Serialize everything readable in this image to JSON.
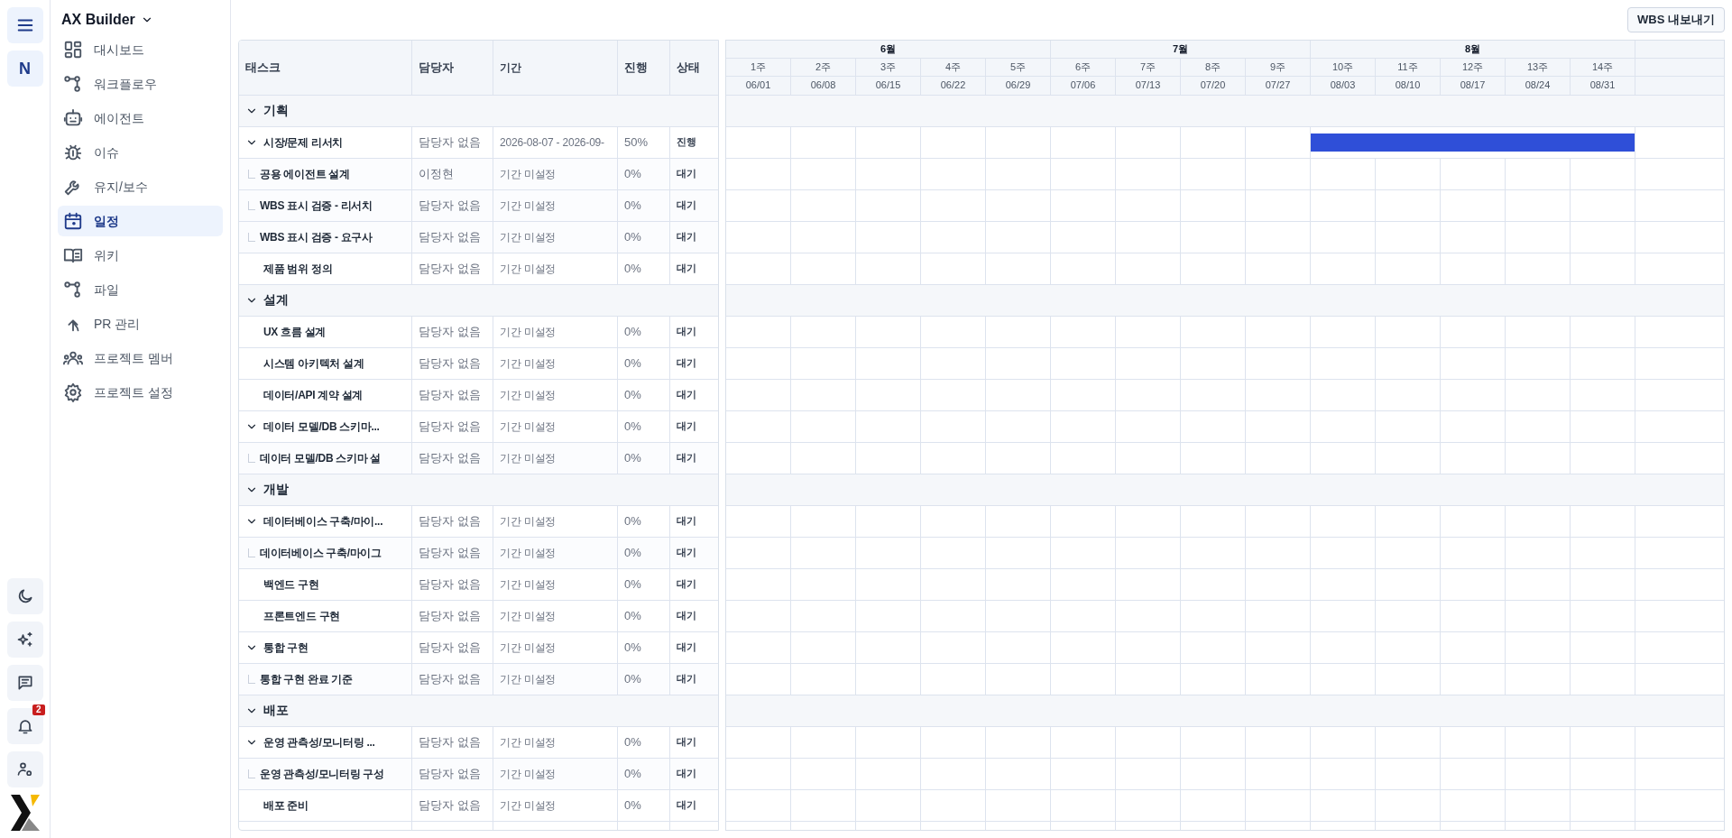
{
  "rail": {
    "avatar": "N",
    "notification_count": "2"
  },
  "project": {
    "title": "AX Builder"
  },
  "nav": [
    {
      "label": "대시보드",
      "selected": false
    },
    {
      "label": "워크플로우",
      "selected": false
    },
    {
      "label": "에이전트",
      "selected": false
    },
    {
      "label": "이슈",
      "selected": false
    },
    {
      "label": "유지/보수",
      "selected": false
    },
    {
      "label": "일정",
      "selected": true
    },
    {
      "label": "위키",
      "selected": false
    },
    {
      "label": "파일",
      "selected": false
    },
    {
      "label": "PR 관리",
      "selected": false
    },
    {
      "label": "프로젝트 멤버",
      "selected": false
    },
    {
      "label": "프로젝트 설정",
      "selected": false
    }
  ],
  "export_button": "WBS 내보내기",
  "table": {
    "columns": [
      "태스크",
      "담당자",
      "기간",
      "진행",
      "상태"
    ]
  },
  "months": [
    {
      "label": "6월",
      "weeks": [
        {
          "label": "1주",
          "date": "06/01"
        },
        {
          "label": "2주",
          "date": "06/08"
        },
        {
          "label": "3주",
          "date": "06/15"
        },
        {
          "label": "4주",
          "date": "06/22"
        },
        {
          "label": "5주",
          "date": "06/29"
        }
      ]
    },
    {
      "label": "7월",
      "weeks": [
        {
          "label": "6주",
          "date": "07/06"
        },
        {
          "label": "7주",
          "date": "07/13"
        },
        {
          "label": "8주",
          "date": "07/20"
        },
        {
          "label": "9주",
          "date": "07/27"
        }
      ]
    },
    {
      "label": "8월",
      "weeks": [
        {
          "label": "10주",
          "date": "08/03"
        },
        {
          "label": "11주",
          "date": "08/10"
        },
        {
          "label": "12주",
          "date": "08/17"
        },
        {
          "label": "13주",
          "date": "08/24"
        },
        {
          "label": "14주",
          "date": "08/31"
        }
      ]
    }
  ],
  "groups": [
    {
      "name": "기획",
      "expanded": true,
      "tasks": [
        {
          "name": "시장/문제 리서치",
          "assignee": "담당자 없음",
          "period": "2026-08-07 - 2026-09-",
          "progress": "50%",
          "status": "진행",
          "expanded": true,
          "timeline": [
            false,
            false,
            false,
            false,
            false,
            false,
            false,
            false,
            false,
            true,
            true,
            true,
            true,
            true
          ],
          "children": [
            {
              "name": "공용 에이전트 설계",
              "assignee": "이정현",
              "period": "기간 미설정",
              "progress": "0%",
              "status": "대기"
            },
            {
              "name": "WBS 표시 검증 - 리서치",
              "assignee": "담당자 없음",
              "period": "기간 미설정",
              "progress": "0%",
              "status": "대기"
            },
            {
              "name": "WBS 표시 검증 - 요구사",
              "assignee": "담당자 없음",
              "period": "기간 미설정",
              "progress": "0%",
              "status": "대기"
            }
          ]
        },
        {
          "name": "제품 범위 정의",
          "assignee": "담당자 없음",
          "period": "기간 미설정",
          "progress": "0%",
          "status": "대기"
        }
      ]
    },
    {
      "name": "설계",
      "expanded": true,
      "tasks": [
        {
          "name": "UX 흐름 설계",
          "assignee": "담당자 없음",
          "period": "기간 미설정",
          "progress": "0%",
          "status": "대기"
        },
        {
          "name": "시스템 아키텍처 설계",
          "assignee": "담당자 없음",
          "period": "기간 미설정",
          "progress": "0%",
          "status": "대기"
        },
        {
          "name": "데이터/API 계약 설계",
          "assignee": "담당자 없음",
          "period": "기간 미설정",
          "progress": "0%",
          "status": "대기"
        },
        {
          "name": "데이터 모델/DB 스키마...",
          "assignee": "담당자 없음",
          "period": "기간 미설정",
          "progress": "0%",
          "status": "대기",
          "expanded": true,
          "children": [
            {
              "name": "데이터 모델/DB 스키마 설",
              "assignee": "담당자 없음",
              "period": "기간 미설정",
              "progress": "0%",
              "status": "대기"
            }
          ]
        }
      ]
    },
    {
      "name": "개발",
      "expanded": true,
      "tasks": [
        {
          "name": "데이터베이스 구축/마이...",
          "assignee": "담당자 없음",
          "period": "기간 미설정",
          "progress": "0%",
          "status": "대기",
          "expanded": true,
          "children": [
            {
              "name": "데이터베이스 구축/마이그",
              "assignee": "담당자 없음",
              "period": "기간 미설정",
              "progress": "0%",
              "status": "대기"
            }
          ]
        },
        {
          "name": "백엔드 구현",
          "assignee": "담당자 없음",
          "period": "기간 미설정",
          "progress": "0%",
          "status": "대기"
        },
        {
          "name": "프론트엔드 구현",
          "assignee": "담당자 없음",
          "period": "기간 미설정",
          "progress": "0%",
          "status": "대기"
        },
        {
          "name": "통합 구현",
          "assignee": "담당자 없음",
          "period": "기간 미설정",
          "progress": "0%",
          "status": "대기",
          "expanded": true,
          "children": [
            {
              "name": "통합 구현 완료 기준",
              "assignee": "담당자 없음",
              "period": "기간 미설정",
              "progress": "0%",
              "status": "대기"
            }
          ]
        }
      ]
    },
    {
      "name": "배포",
      "expanded": true,
      "tasks": [
        {
          "name": "운영 관측성/모니터링 ...",
          "assignee": "담당자 없음",
          "period": "기간 미설정",
          "progress": "0%",
          "status": "대기",
          "expanded": true,
          "children": [
            {
              "name": "운영 관측성/모니터링 구성",
              "assignee": "담당자 없음",
              "period": "기간 미설정",
              "progress": "0%",
              "status": "대기"
            }
          ]
        },
        {
          "name": "배포 준비",
          "assignee": "담당자 없음",
          "period": "기간 미설정",
          "progress": "0%",
          "status": "대기"
        }
      ]
    }
  ]
}
